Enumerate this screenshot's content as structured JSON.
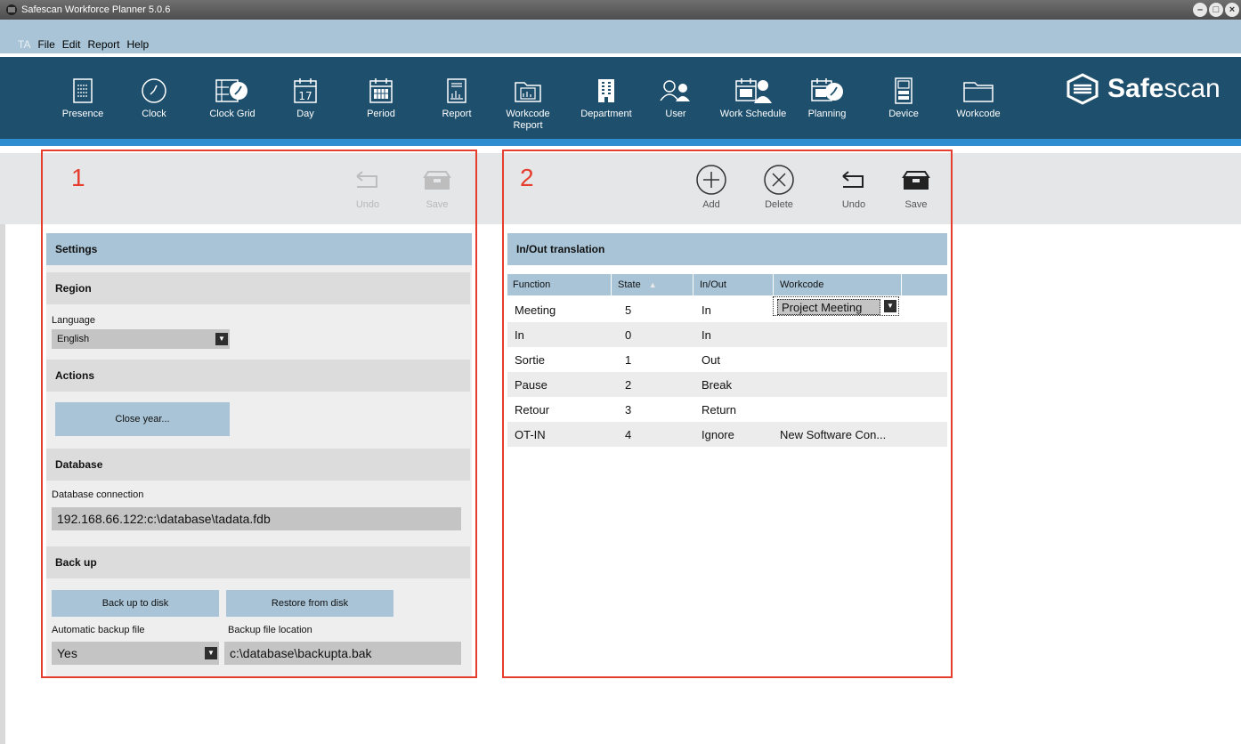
{
  "window": {
    "title": "Safescan Workforce Planner 5.0.6",
    "controls": [
      "minimize",
      "maximize",
      "close"
    ]
  },
  "menu": {
    "ta": "TA",
    "items": [
      "File",
      "Edit",
      "Report",
      "Help"
    ]
  },
  "toolbar": {
    "items": [
      {
        "label": "Presence",
        "icon": "presence-icon"
      },
      {
        "label": "Clock",
        "icon": "clock-icon"
      },
      {
        "label": "Clock Grid",
        "icon": "clock-grid-icon"
      },
      {
        "label": "Day",
        "icon": "day-calendar-icon",
        "day_number": "17"
      },
      {
        "label": "Period",
        "icon": "period-calendar-icon"
      },
      {
        "label": "Report",
        "icon": "report-icon"
      },
      {
        "label": "Workcode\nReport",
        "icon": "workcode-report-icon"
      },
      {
        "label": "Department",
        "icon": "department-icon"
      },
      {
        "label": "User",
        "icon": "user-icon"
      },
      {
        "label": "Work Schedule",
        "icon": "work-schedule-icon"
      },
      {
        "label": "Planning",
        "icon": "planning-icon"
      },
      {
        "label": "Device",
        "icon": "device-icon"
      },
      {
        "label": "Workcode",
        "icon": "workcode-folder-icon"
      }
    ],
    "logo": {
      "bold": "Safe",
      "rest": "scan"
    }
  },
  "panel1": {
    "number": "1",
    "actions": {
      "undo": "Undo",
      "save": "Save"
    },
    "settings_header": "Settings",
    "region": {
      "header": "Region",
      "language_label": "Language",
      "language_value": "English"
    },
    "actions_section": {
      "header": "Actions",
      "close_year": "Close year..."
    },
    "database": {
      "header": "Database",
      "connection_label": "Database connection",
      "connection_value": "192.168.66.122:c:\\database\\tadata.fdb"
    },
    "backup": {
      "header": "Back up",
      "backup_button": "Back up to disk",
      "restore_button": "Restore from disk",
      "auto_label": "Automatic backup file",
      "auto_value": "Yes",
      "location_label": "Backup file location",
      "location_value": "c:\\database\\backupta.bak"
    }
  },
  "panel2": {
    "number": "2",
    "actions": {
      "add": "Add",
      "delete": "Delete",
      "undo": "Undo",
      "save": "Save"
    },
    "header": "In/Out translation",
    "columns": {
      "function": "Function",
      "state": "State",
      "inout": "In/Out",
      "workcode": "Workcode"
    },
    "rows": [
      {
        "function": "Meeting",
        "state": "5",
        "inout": "In",
        "workcode": "Project Meeting"
      },
      {
        "function": "In",
        "state": "0",
        "inout": "In",
        "workcode": ""
      },
      {
        "function": "Sortie",
        "state": "1",
        "inout": "Out",
        "workcode": ""
      },
      {
        "function": "Pause",
        "state": "2",
        "inout": "Break",
        "workcode": ""
      },
      {
        "function": "Retour",
        "state": "3",
        "inout": "Return",
        "workcode": ""
      },
      {
        "function": "OT-IN",
        "state": "4",
        "inout": "Ignore",
        "workcode": "New Software Con..."
      }
    ]
  },
  "colors": {
    "toolbar": "#1e4f6d",
    "accent_stripe": "#2e8ed0",
    "section_blue": "#a8c4d6",
    "highlight_outline": "#e53e2e"
  }
}
